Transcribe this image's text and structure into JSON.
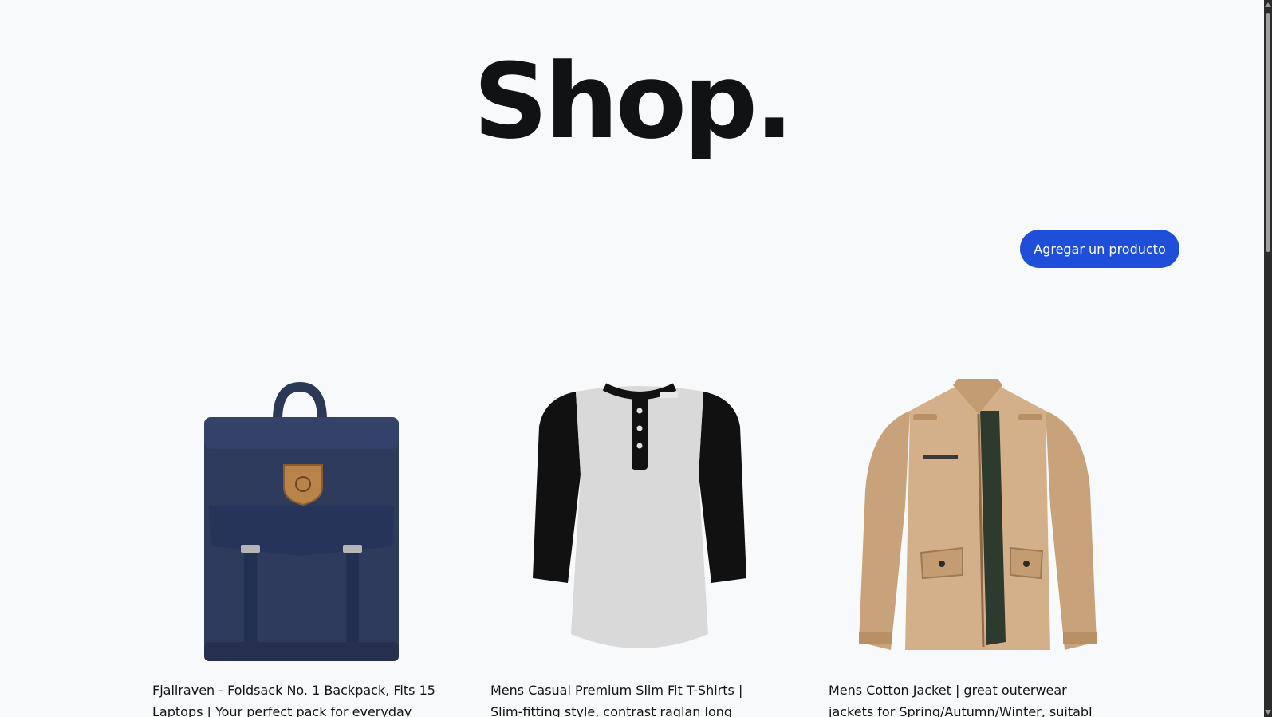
{
  "header": {
    "title": "Shop."
  },
  "actions": {
    "add_product_label": "Agregar un producto"
  },
  "products": [
    {
      "title": "Fjallraven - Foldsack No. 1 Backpack, Fits 15 Laptops | Your perfect pack for everyday",
      "image_icon": "backpack-image"
    },
    {
      "title": "Mens Casual Premium Slim Fit T-Shirts | Slim-fitting style, contrast raglan long",
      "image_icon": "tshirt-image"
    },
    {
      "title": "Mens Cotton Jacket | great outerwear jackets for Spring/Autumn/Winter, suitabl",
      "image_icon": "jacket-image"
    }
  ],
  "colors": {
    "background": "#f7f9fb",
    "accent": "#1f4fd8",
    "text": "#111214"
  }
}
